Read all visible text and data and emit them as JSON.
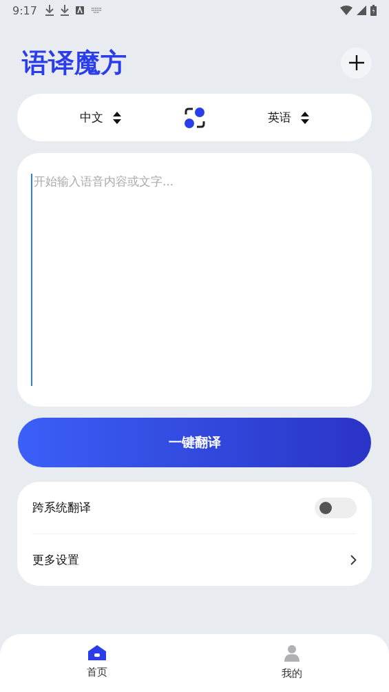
{
  "status_bar": {
    "time": "9:17"
  },
  "header": {
    "title": "语译魔方"
  },
  "languages": {
    "source": "中文",
    "target": "英语"
  },
  "input": {
    "placeholder": "开始输入语音内容或文字..."
  },
  "translate_button": "一键翻译",
  "settings": [
    {
      "kind": "toggle",
      "label": "跨系统翻译",
      "on": false
    },
    {
      "kind": "link",
      "label": "更多设置"
    }
  ],
  "nav": [
    {
      "label": "首页",
      "kind": "home",
      "selected": true
    },
    {
      "label": "我的",
      "kind": "person",
      "selected": false
    }
  ]
}
